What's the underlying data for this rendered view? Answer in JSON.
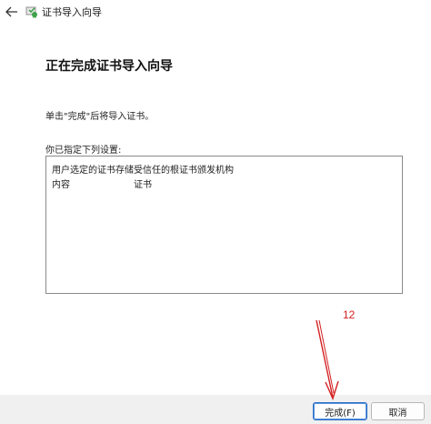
{
  "window": {
    "title": "证书导入向导",
    "back_icon": "back-arrow-icon",
    "app_icon": "certificate-wizard-icon"
  },
  "main": {
    "heading": "正在完成证书导入向导",
    "instruction": "单击\"完成\"后将导入证书。",
    "settings_label": "你已指定下列设置:",
    "settings": [
      {
        "key": "用户选定的证书存储",
        "value": "受信任的根证书颁发机构"
      },
      {
        "key": "内容",
        "value": "证书"
      }
    ]
  },
  "footer": {
    "finish_label": "完成(F)",
    "cancel_label": "取消"
  },
  "annotation": {
    "number": "12",
    "color": "#d42020"
  },
  "colors": {
    "footer_bg": "#f0f0f0",
    "primary_border": "#2b6cc4"
  }
}
